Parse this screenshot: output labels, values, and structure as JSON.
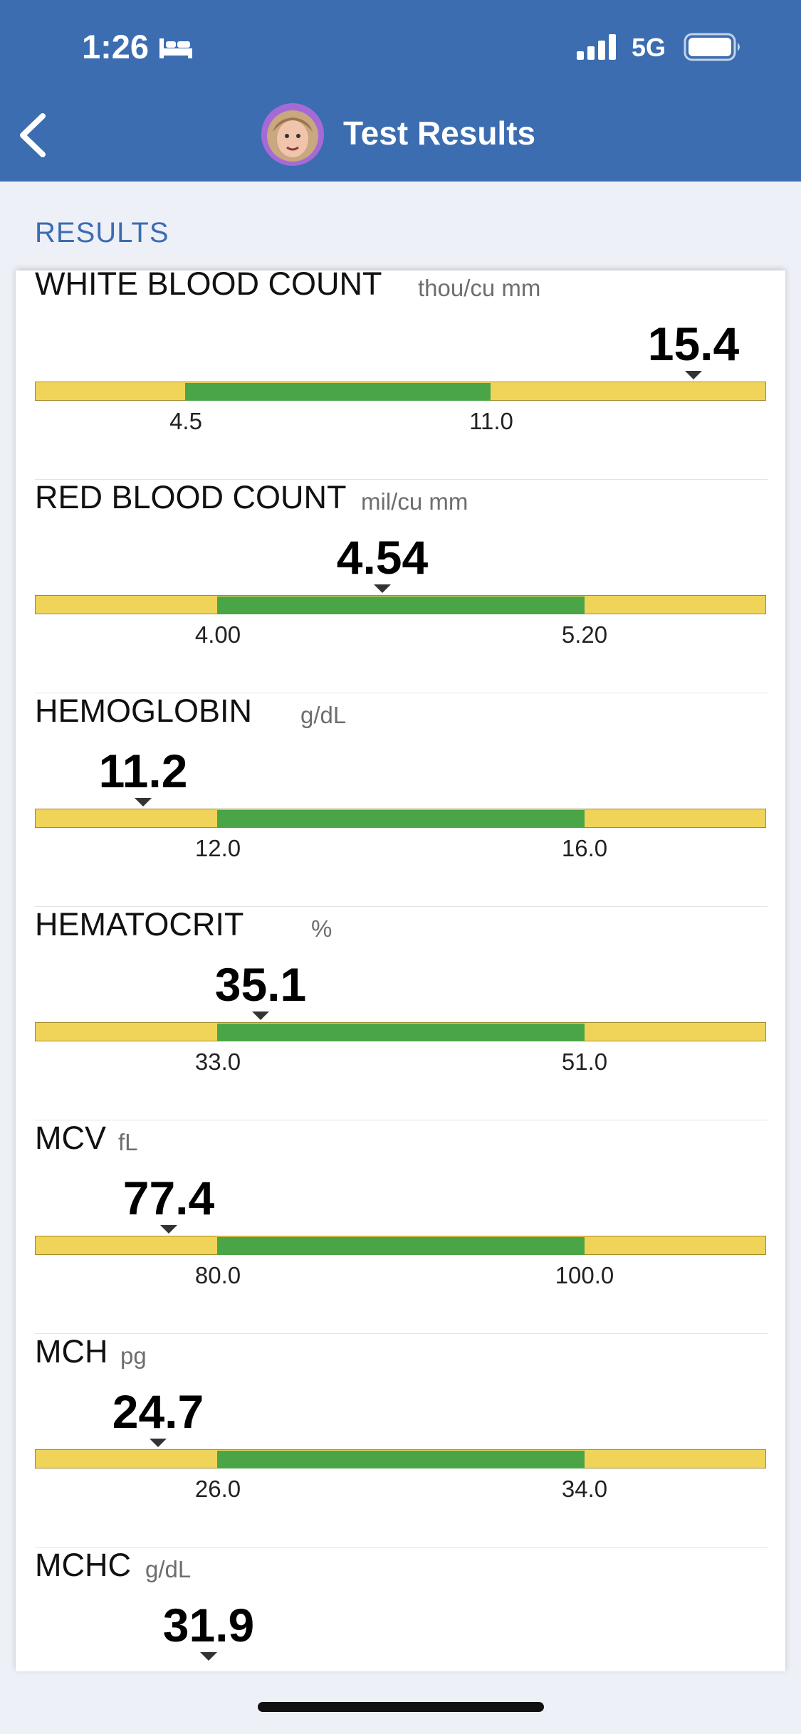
{
  "status": {
    "time": "1:26",
    "network": "5G",
    "icons": [
      "bed-icon",
      "signal-icon",
      "battery-icon"
    ]
  },
  "header": {
    "title": "Test Results",
    "back_icon": "chevron-left-icon",
    "avatar": "avatar"
  },
  "section": {
    "label": "RESULTS"
  },
  "colors": {
    "brand": "#3b6db0",
    "normal_range": "#4aa547",
    "abnormal_range": "#f0d45a"
  },
  "results": [
    {
      "name": "WHITE BLOOD COUNT",
      "unit": "thou/cu mm",
      "value": "15.4",
      "low": "4.5",
      "high": "11.0"
    },
    {
      "name": "RED BLOOD COUNT",
      "unit": "mil/cu mm",
      "value": "4.54",
      "low": "4.00",
      "high": "5.20"
    },
    {
      "name": "HEMOGLOBIN",
      "unit": "g/dL",
      "value": "11.2",
      "low": "12.0",
      "high": "16.0"
    },
    {
      "name": "HEMATOCRIT",
      "unit": "%",
      "value": "35.1",
      "low": "33.0",
      "high": "51.0"
    },
    {
      "name": "MCV",
      "unit": "fL",
      "value": "77.4",
      "low": "80.0",
      "high": "100.0"
    },
    {
      "name": "MCH",
      "unit": "pg",
      "value": "24.7",
      "low": "26.0",
      "high": "34.0"
    },
    {
      "name": "MCHC",
      "unit": "g/dL",
      "value": "31.9"
    }
  ]
}
